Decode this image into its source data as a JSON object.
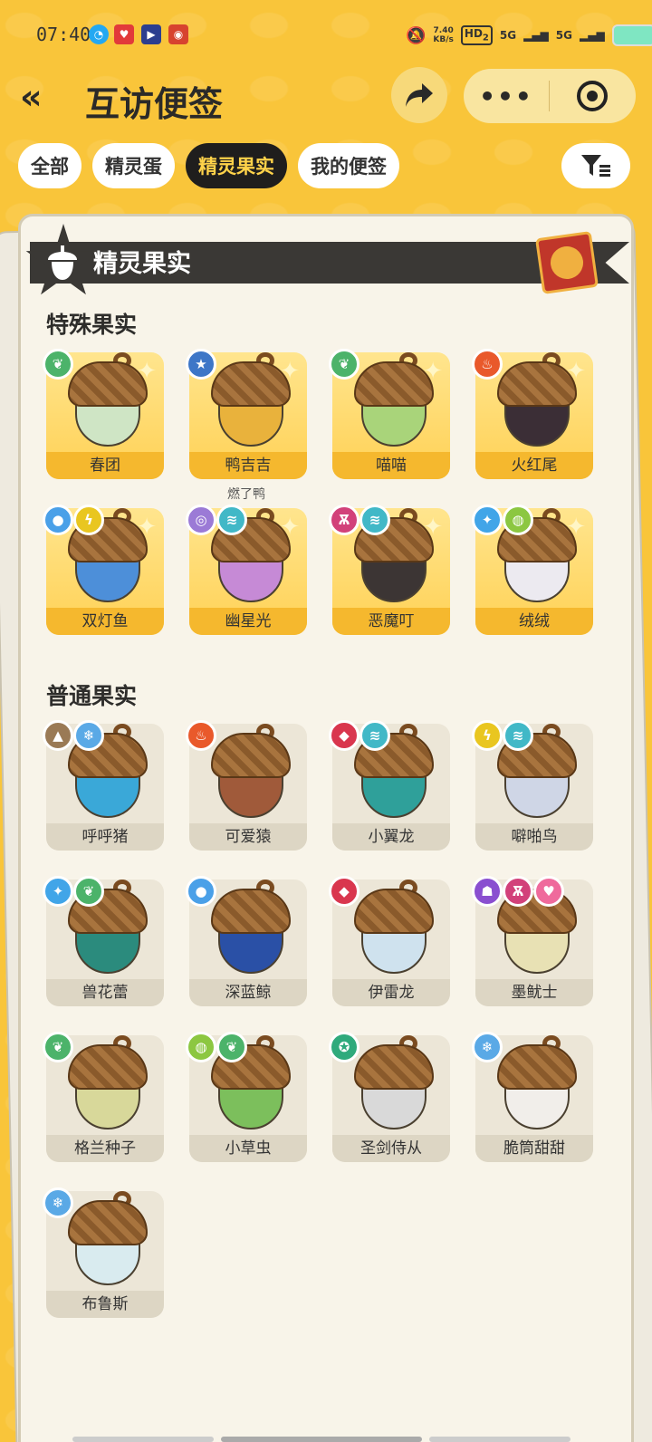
{
  "status": {
    "time": "07:40",
    "speed_value": "7.40",
    "speed_unit": "KB/s",
    "hd": "HD",
    "hd_sub": "2",
    "net1": "5G",
    "net2": "5G"
  },
  "header": {
    "back_label": "«",
    "title": "互访便签",
    "more_label": "•••"
  },
  "tabs": [
    {
      "label": "全部"
    },
    {
      "label": "精灵蛋"
    },
    {
      "label": "精灵果实"
    },
    {
      "label": "我的便签"
    }
  ],
  "panel": {
    "title": "精灵果实"
  },
  "special": {
    "heading": "特殊果实",
    "items": [
      {
        "name": "春团",
        "nut": "#cfe5c5",
        "types": [
          {
            "icon": "leaf",
            "color": "#4cb36a"
          }
        ]
      },
      {
        "name": "鸭吉吉",
        "nut": "#e9b23c",
        "types": [
          {
            "icon": "star",
            "color": "#3d76c7"
          }
        ],
        "note": "燃了鸭"
      },
      {
        "name": "喵喵",
        "nut": "#a9d47a",
        "types": [
          {
            "icon": "leaf",
            "color": "#4cb36a"
          }
        ]
      },
      {
        "name": "火红尾",
        "nut": "#3b2e36",
        "types": [
          {
            "icon": "fire",
            "color": "#e9592b"
          }
        ]
      },
      {
        "name": "双灯鱼",
        "nut": "#4d8fd9",
        "types": [
          {
            "icon": "water",
            "color": "#4aa0e8"
          },
          {
            "icon": "bolt",
            "color": "#e9c620"
          }
        ]
      },
      {
        "name": "幽星光",
        "nut": "#c68ad6",
        "types": [
          {
            "icon": "spiral",
            "color": "#9b7ad6"
          },
          {
            "icon": "wing",
            "color": "#41b8c7"
          }
        ]
      },
      {
        "name": "恶魔叮",
        "nut": "#3c3534",
        "types": [
          {
            "icon": "demon",
            "color": "#d2417a"
          },
          {
            "icon": "wing",
            "color": "#41b8c7"
          }
        ]
      },
      {
        "name": "绒绒",
        "nut": "#eceaf0",
        "types": [
          {
            "icon": "fairy",
            "color": "#41a5e8"
          },
          {
            "icon": "bug",
            "color": "#8cc741"
          }
        ]
      }
    ]
  },
  "normal": {
    "heading": "普通果实",
    "items": [
      {
        "name": "呼呼猪",
        "nut": "#3aa8d8",
        "types": [
          {
            "icon": "mount",
            "color": "#9a7a55"
          },
          {
            "icon": "ice",
            "color": "#5aa9e6"
          }
        ]
      },
      {
        "name": "可爱猿",
        "nut": "#a05a3a",
        "types": [
          {
            "icon": "fire",
            "color": "#e9592b"
          }
        ]
      },
      {
        "name": "小翼龙",
        "nut": "#2fa09a",
        "types": [
          {
            "icon": "dragon",
            "color": "#d9364e"
          },
          {
            "icon": "wing",
            "color": "#41b8c7"
          }
        ]
      },
      {
        "name": "噼啪鸟",
        "nut": "#cfd6e6",
        "types": [
          {
            "icon": "bolt",
            "color": "#e9c620"
          },
          {
            "icon": "wing",
            "color": "#41b8c7"
          }
        ]
      },
      {
        "name": "兽花蕾",
        "nut": "#2b8b7d",
        "types": [
          {
            "icon": "fairy",
            "color": "#41a5e8"
          },
          {
            "icon": "leaf",
            "color": "#4cb36a"
          }
        ]
      },
      {
        "name": "深蓝鲸",
        "nut": "#2a50a6",
        "types": [
          {
            "icon": "water",
            "color": "#4aa0e8"
          }
        ]
      },
      {
        "name": "伊雷龙",
        "nut": "#cfe2ee",
        "types": [
          {
            "icon": "dragon",
            "color": "#d9364e"
          }
        ]
      },
      {
        "name": "墨鱿士",
        "nut": "#e8e1b4",
        "types": [
          {
            "icon": "ghost",
            "color": "#8a4fd0"
          },
          {
            "icon": "demon",
            "color": "#d2417a"
          },
          {
            "icon": "heart",
            "color": "#ef6a9c"
          }
        ]
      },
      {
        "name": "格兰种子",
        "nut": "#d8d89a",
        "types": [
          {
            "icon": "leaf",
            "color": "#4cb36a"
          }
        ]
      },
      {
        "name": "小草虫",
        "nut": "#7cbf5c",
        "types": [
          {
            "icon": "bug",
            "color": "#8cc741"
          },
          {
            "icon": "leaf",
            "color": "#4cb36a"
          }
        ]
      },
      {
        "name": "圣剑侍从",
        "nut": "#d9d9d9",
        "types": [
          {
            "icon": "gear",
            "color": "#2faa7c"
          }
        ]
      },
      {
        "name": "脆筒甜甜",
        "nut": "#f1eeea",
        "types": [
          {
            "icon": "ice",
            "color": "#5aa9e6"
          }
        ]
      },
      {
        "name": "布鲁斯",
        "nut": "#d9ebef",
        "types": [
          {
            "icon": "ice",
            "color": "#5aa9e6"
          }
        ]
      }
    ]
  }
}
